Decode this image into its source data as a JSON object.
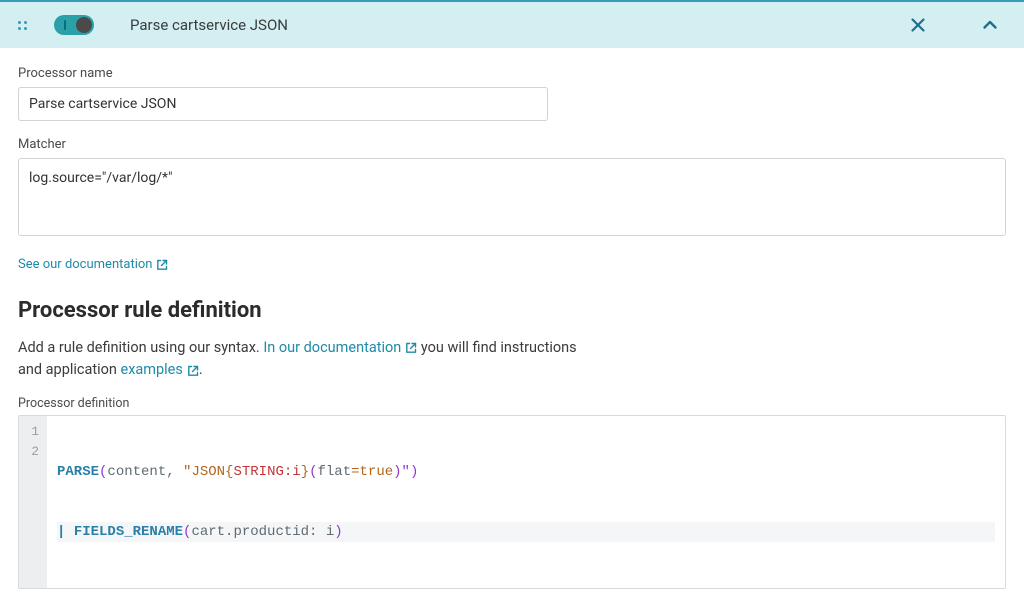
{
  "header": {
    "title": "Parse cartservice JSON",
    "toggle_on": true
  },
  "fields": {
    "name_label": "Processor name",
    "name_value": "Parse cartservice JSON",
    "matcher_label": "Matcher",
    "matcher_value": "log.source=\"/var/log/*\""
  },
  "links": {
    "see_docs": "See our documentation",
    "in_docs": "In our documentation",
    "examples": "examples"
  },
  "section": {
    "heading": "Processor rule definition",
    "desc_prefix": "Add a rule definition using our syntax. ",
    "desc_mid": " you will find instructions and application ",
    "desc_suffix": ".",
    "def_label": "Processor definition"
  },
  "code": {
    "line_numbers": [
      "1",
      "2"
    ],
    "tokens": {
      "parse": "PARSE",
      "content": "content",
      "json_open": "\"JSON{",
      "string_i": "STRING:i",
      "json_close": "}",
      "flat_open": "(",
      "flat": "flat",
      "eq_true": "=true",
      "flat_close": ")\"",
      "pipe": "|",
      "fields_rename": "FIELDS_RENAME",
      "rename_arg": "cart.productid: i"
    }
  }
}
